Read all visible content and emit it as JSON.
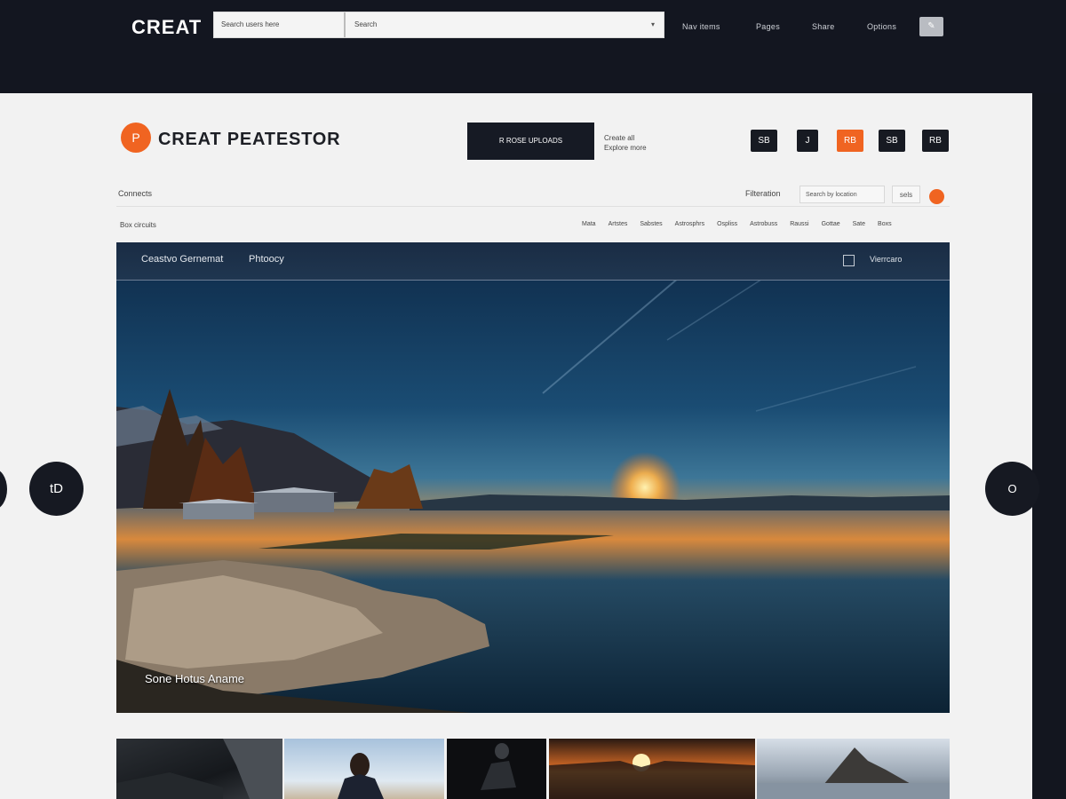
{
  "topbar": {
    "brand": "CREAT",
    "search_left": "Search users here",
    "search_right": "Search",
    "nav": [
      "Nav items",
      "Pages",
      "Share",
      "Options"
    ],
    "square_icon": "edit-icon"
  },
  "header": {
    "logo_letter": "P",
    "logo_text": "CREAT PEATESTOR",
    "cta_label": "R ROSE UPLOADS",
    "cta_side_lines": [
      "Create all",
      "Explore more"
    ],
    "icon_buttons": [
      "SB",
      "J",
      "RB",
      "SB",
      "RB"
    ]
  },
  "filters": {
    "section_label": "Connects",
    "filter_label": "Filteration",
    "filter_input": "Search by location",
    "filter_small": "sels"
  },
  "subnav": {
    "left_label": "Box circuits",
    "items": [
      "Mata",
      "Artstes",
      "Sabstes",
      "Astrosphrs",
      "Ospliss",
      "Astrobuss",
      "Raussi",
      "Gottae",
      "Sate",
      "Boxs"
    ]
  },
  "hero": {
    "tab1": "Ceastvo Gernemat",
    "tab2": "Phtoocy",
    "right_label": "Vierrcaro",
    "caption": "Sone Hotus Aname"
  },
  "carousel": {
    "prev_label": "tD",
    "next_label": "O"
  },
  "colors": {
    "accent": "#f06421",
    "dark": "#161a24",
    "panel": "#f2f2f2"
  }
}
